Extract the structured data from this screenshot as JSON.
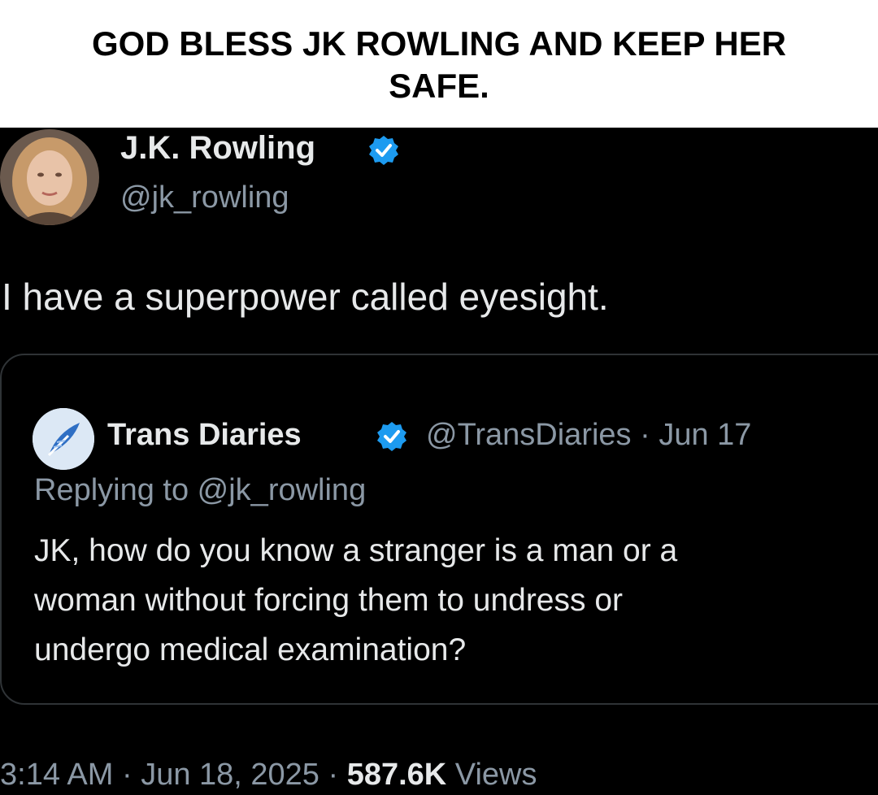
{
  "caption": {
    "line1": "GOD BLESS JK ROWLING AND KEEP HER",
    "line2": "SAFE."
  },
  "tweet": {
    "author_name": "J.K. Rowling",
    "author_handle": "@jk_rowling",
    "verified_icon": "verified-badge-icon",
    "text": "I have a superpower called eyesight.",
    "timestamp": "3:14 AM · Jun 18, 2025 · ",
    "views_count": "587.6K",
    "views_label": " Views"
  },
  "quoted_tweet": {
    "author_name": "Trans Diaries",
    "author_handle": "@TransDiaries",
    "date": "Jun 17",
    "separator": " · ",
    "replying_to": "Replying to @jk_rowling",
    "text_lines": [
      "JK, how do you know a stranger is a man or a",
      "woman without forcing them to undress or",
      "undergo medical examination?"
    ]
  },
  "colors": {
    "background": "#000000",
    "text_primary": "#e7e9ea",
    "text_secondary": "#8b98a5",
    "verified": "#1d9bf0",
    "border": "#2f3336"
  }
}
